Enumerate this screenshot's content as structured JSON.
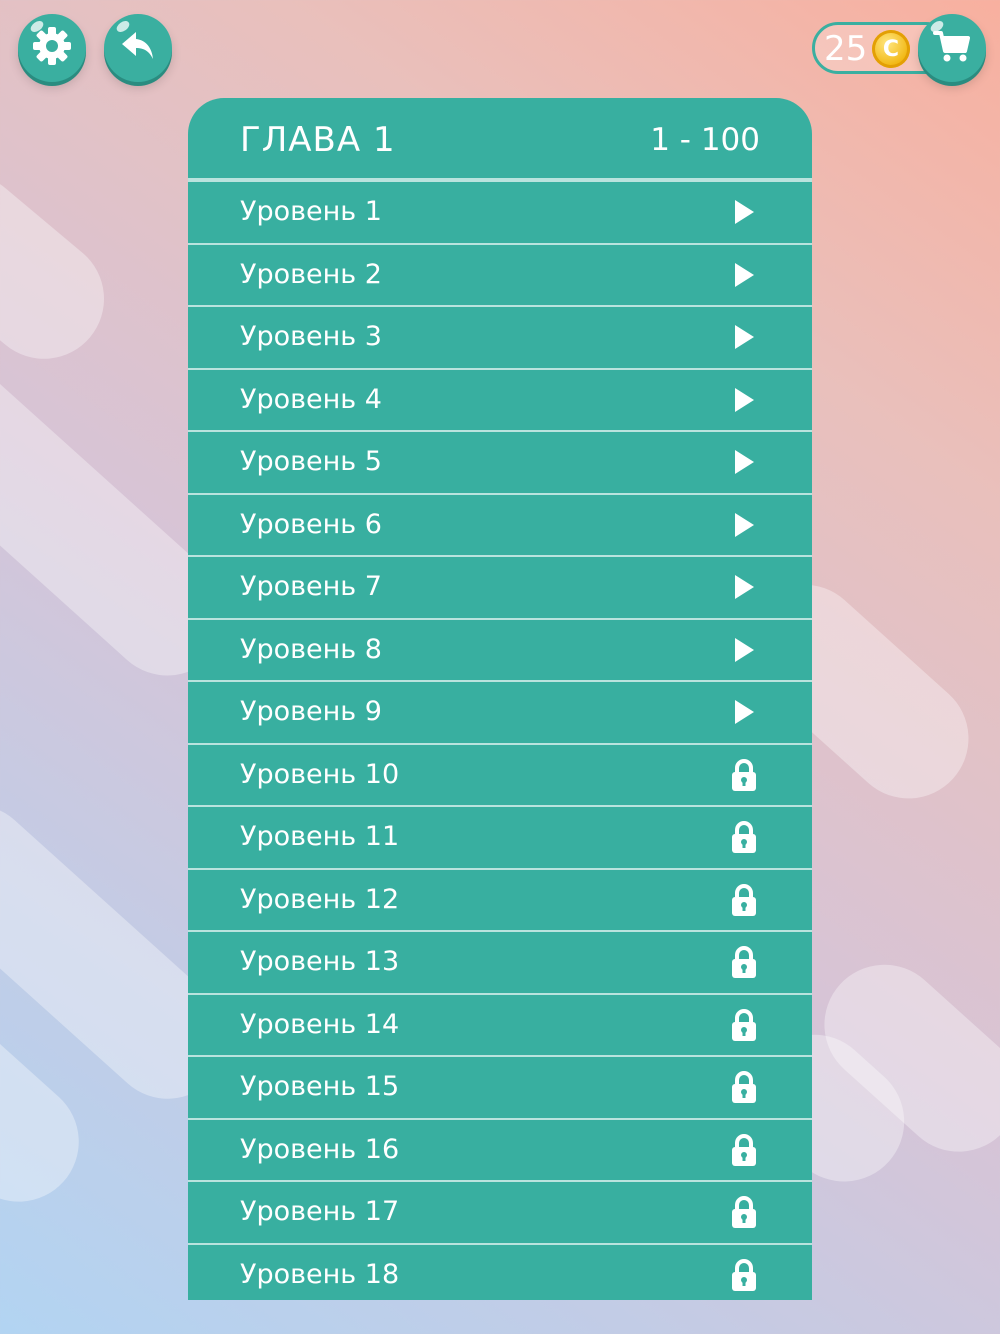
{
  "toolbar": {
    "settings_icon": "gear-icon",
    "back_icon": "back-arrow-icon",
    "cart_icon": "cart-icon"
  },
  "wallet": {
    "coins": "25",
    "coin_symbol": "C"
  },
  "chapter": {
    "title": "ГЛАВА 1",
    "range": "1 - 100"
  },
  "levels": [
    {
      "label": "Уровень 1",
      "state": "unlocked"
    },
    {
      "label": "Уровень 2",
      "state": "unlocked"
    },
    {
      "label": "Уровень 3",
      "state": "unlocked"
    },
    {
      "label": "Уровень 4",
      "state": "unlocked"
    },
    {
      "label": "Уровень 5",
      "state": "unlocked"
    },
    {
      "label": "Уровень 6",
      "state": "unlocked"
    },
    {
      "label": "Уровень 7",
      "state": "unlocked"
    },
    {
      "label": "Уровень 8",
      "state": "unlocked"
    },
    {
      "label": "Уровень 9",
      "state": "unlocked"
    },
    {
      "label": "Уровень 10",
      "state": "locked"
    },
    {
      "label": "Уровень 11",
      "state": "locked"
    },
    {
      "label": "Уровень 12",
      "state": "locked"
    },
    {
      "label": "Уровень 13",
      "state": "locked"
    },
    {
      "label": "Уровень 14",
      "state": "locked"
    },
    {
      "label": "Уровень 15",
      "state": "locked"
    },
    {
      "label": "Уровень 16",
      "state": "locked"
    },
    {
      "label": "Уровень 17",
      "state": "locked"
    },
    {
      "label": "Уровень 18",
      "state": "locked"
    }
  ],
  "colors": {
    "accent": "#38afa0",
    "divider": "#b9e3de",
    "coin": "#f1b50e"
  }
}
